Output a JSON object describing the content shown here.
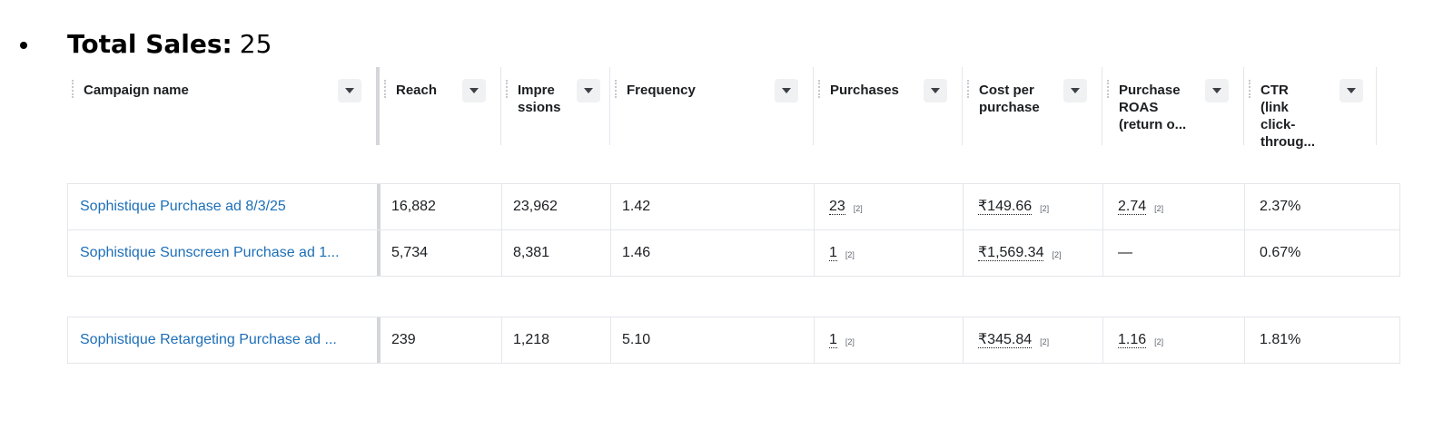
{
  "summary": {
    "label": "Total Sales:",
    "value": "25"
  },
  "columns": [
    {
      "label": "Campaign name"
    },
    {
      "label": "Reach"
    },
    {
      "label": "Impre ssions"
    },
    {
      "label": "Frequency"
    },
    {
      "label": "Purchases"
    },
    {
      "label": "Cost per purchase"
    },
    {
      "label": "Purchase ROAS (return o..."
    },
    {
      "label": "CTR (link click- throug..."
    }
  ],
  "rows": [
    {
      "campaign": "Sophistique Purchase ad 8/3/25",
      "reach": "16,882",
      "impressions": "23,962",
      "frequency": "1.42",
      "purchases": "23",
      "purchases_note": "[2]",
      "cost_per_purchase": "₹149.66",
      "cost_note": "[2]",
      "roas": "2.74",
      "roas_note": "[2]",
      "ctr": "2.37%"
    },
    {
      "campaign": "Sophistique Sunscreen Purchase ad 1...",
      "reach": "5,734",
      "impressions": "8,381",
      "frequency": "1.46",
      "purchases": "1",
      "purchases_note": "[2]",
      "cost_per_purchase": "₹1,569.34",
      "cost_note": "[2]",
      "roas": "—",
      "ctr": "0.67%"
    },
    {
      "campaign": "Sophistique Retargeting Purchase ad ...",
      "reach": "239",
      "impressions": "1,218",
      "frequency": "5.10",
      "purchases": "1",
      "purchases_note": "[2]",
      "cost_per_purchase": "₹345.84",
      "cost_note": "[2]",
      "roas": "1.16",
      "roas_note": "[2]",
      "ctr": "1.81%"
    }
  ],
  "icons": {
    "sort": "caret-down-icon",
    "drag": "column-drag-handle-icon"
  },
  "colors": {
    "link": "#1d6fb8",
    "text": "#1c1e21",
    "border": "#e4e6eb",
    "sort_button_bg": "#f0f1f3"
  }
}
